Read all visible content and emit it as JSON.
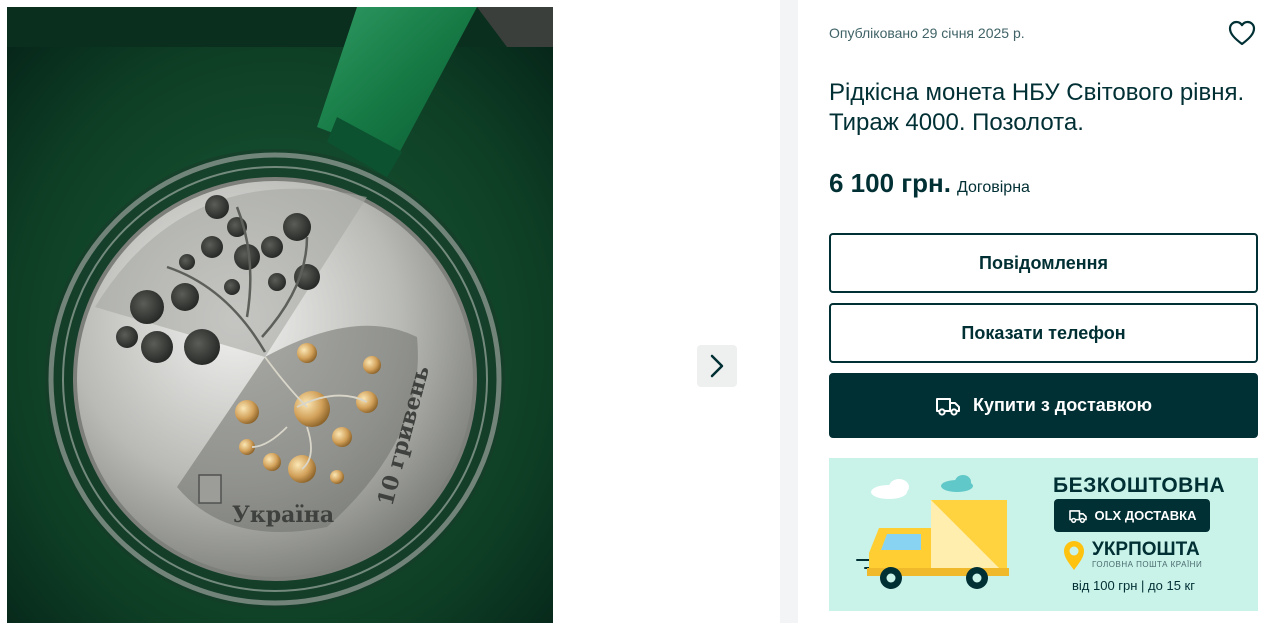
{
  "gallery": {
    "image_alt": "Фото монети",
    "next_icon": "chevron-right-icon"
  },
  "listing": {
    "published": "Опубліковано 29 січня 2025 р.",
    "favorite_icon": "heart-icon",
    "title": "Рідкісна монета НБУ Світового рівня. Тираж 4000. Позолота.",
    "price": "6 100 грн.",
    "negotiable": "Договірна"
  },
  "actions": {
    "message_label": "Повідомлення",
    "phone_label": "Показати телефон",
    "buy_label": "Купити з доставкою",
    "buy_icon": "truck-icon"
  },
  "promo": {
    "free_label": "БЕЗКОШТОВНА",
    "olx_delivery": "OLX ДОСТАВКА",
    "ukrposhta": "УКРПОШТА",
    "ukrposhta_sub": "ГОЛОВНА ПОШТА КРАЇНИ",
    "terms": "від 100 грн | до 15 кг"
  },
  "coin_inscriptions": {
    "country": "Україна",
    "denomination": "10 гривень"
  },
  "colors": {
    "brand_dark": "#002f34",
    "promo_bg": "#c9f2e9",
    "divider": "#f2f4f5"
  }
}
